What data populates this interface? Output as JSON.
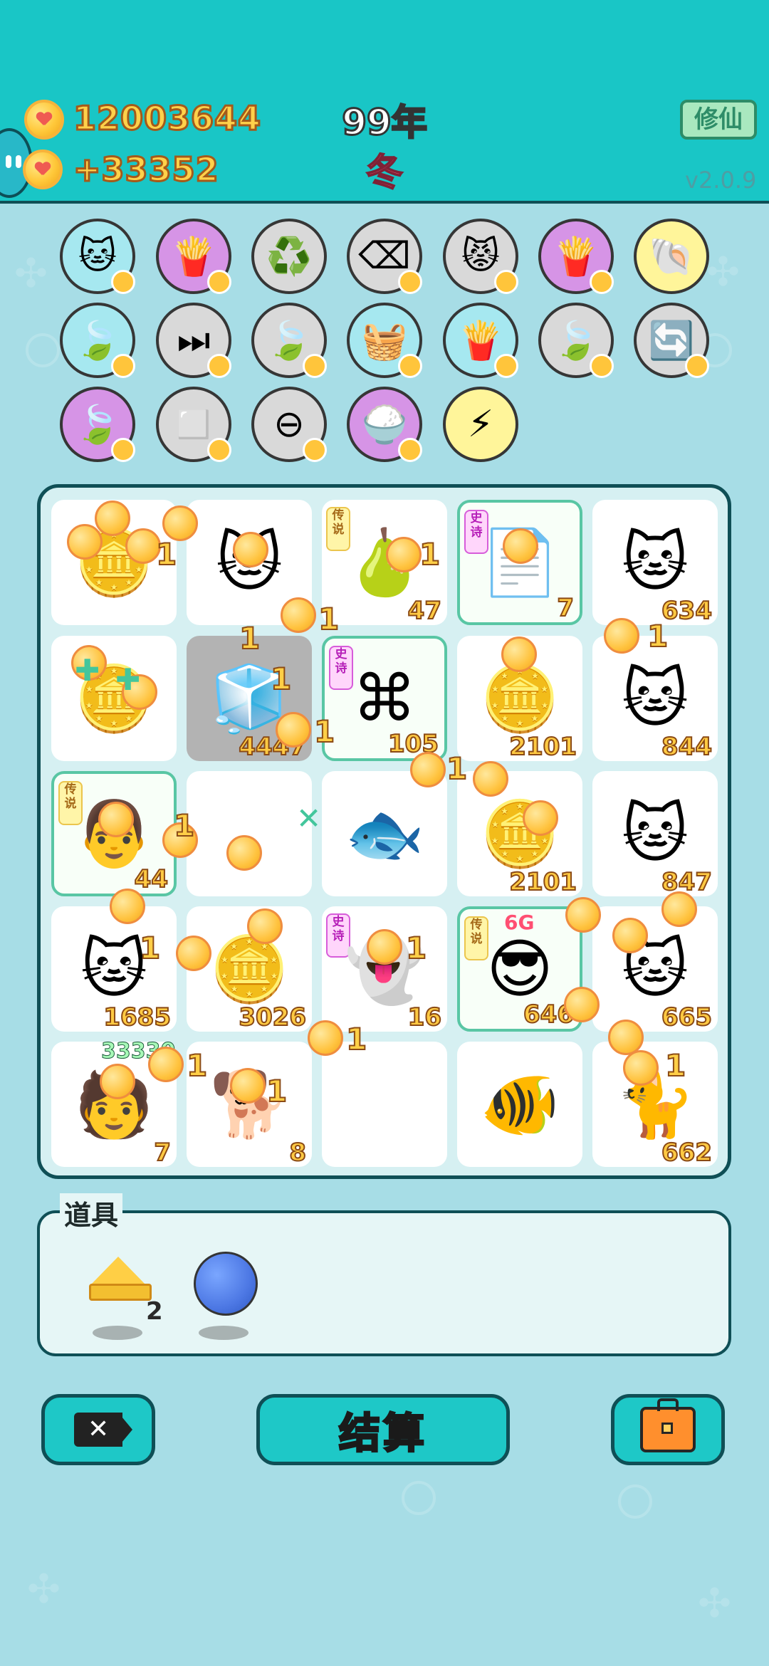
{
  "header": {
    "coin_total": "12003644",
    "coin_income": "+33352",
    "year": "99年",
    "season": "冬",
    "xiuxian_button": "修仙",
    "version": "v2.0.9"
  },
  "skills": [
    {
      "name": "cat-icon",
      "bg": "#a6e8f0"
    },
    {
      "name": "fries-icon",
      "bg": "#d694e6"
    },
    {
      "name": "recycle-icon",
      "bg": "#d9d9d9"
    },
    {
      "name": "delete-tag-icon",
      "bg": "#d9d9d9"
    },
    {
      "name": "dual-cat-icon",
      "bg": "#d9d9d9"
    },
    {
      "name": "fries-icon",
      "bg": "#d694e6"
    },
    {
      "name": "shell-icon",
      "bg": "#fff59a"
    },
    {
      "name": "leaf-icon",
      "bg": "#a6e8f0"
    },
    {
      "name": "skip-icon",
      "bg": "#d9d9d9"
    },
    {
      "name": "leaf-icon",
      "bg": "#d9d9d9"
    },
    {
      "name": "basket-icon",
      "bg": "#a6e8f0"
    },
    {
      "name": "fries-icon",
      "bg": "#a6e8f0"
    },
    {
      "name": "leaf-icon",
      "bg": "#d9d9d9"
    },
    {
      "name": "refresh-icon",
      "bg": "#d9d9d9"
    },
    {
      "name": "leaf-icon",
      "bg": "#d694e6"
    },
    {
      "name": "blocks-icon",
      "bg": "#d9d9d9"
    },
    {
      "name": "minus-icon",
      "bg": "#d9d9d9"
    },
    {
      "name": "rice-icon",
      "bg": "#d694e6"
    },
    {
      "name": "lightning-icon",
      "bg": "#fff59a"
    }
  ],
  "board": {
    "tiles": [
      {
        "value": "",
        "icon": "coin-cluster-icon"
      },
      {
        "value": "",
        "icon": "cat-icon"
      },
      {
        "value": "47",
        "icon": "pear-icon",
        "rarity": "传说"
      },
      {
        "value": "7",
        "icon": "copy-icon",
        "rarity": "史诗"
      },
      {
        "value": "634",
        "icon": "cat-icon"
      },
      {
        "value": "",
        "icon": "coin-cluster-icon"
      },
      {
        "value": "4447",
        "icon": "fridge-icon"
      },
      {
        "value": "105",
        "icon": "ctrl-icon",
        "rarity": "史诗"
      },
      {
        "value": "2101",
        "icon": "coin-cluster-icon"
      },
      {
        "value": "844",
        "icon": "cat-icon"
      },
      {
        "value": "44",
        "icon": "person-icon",
        "rarity": "传说"
      },
      {
        "value": "",
        "icon": "empty-icon"
      },
      {
        "value": "",
        "icon": "fish-icon"
      },
      {
        "value": "2101",
        "icon": "coin-cluster-icon"
      },
      {
        "value": "847",
        "icon": "cat-icon"
      },
      {
        "value": "1685",
        "icon": "cat-icon"
      },
      {
        "value": "3026",
        "icon": "coin-cluster-icon"
      },
      {
        "value": "16",
        "icon": "ghost-icon",
        "rarity": "史诗"
      },
      {
        "value": "646",
        "icon": "king-icon",
        "rarity": "传说",
        "tag": "6G"
      },
      {
        "value": "665",
        "icon": "cat-icon"
      },
      {
        "value": "7",
        "icon": "person-icon",
        "badge": "33330"
      },
      {
        "value": "8",
        "icon": "dog-icon"
      },
      {
        "value": "",
        "icon": "empty-icon"
      },
      {
        "value": "",
        "icon": "fish-icon"
      },
      {
        "value": "662",
        "icon": "cat-icon"
      }
    ],
    "float_label": "1"
  },
  "props": {
    "title": "道具",
    "crown_count": "2"
  },
  "bottom": {
    "settle": "结算"
  },
  "colors": {
    "topbar": "#19c6c6",
    "accent": "#ffcf47"
  }
}
